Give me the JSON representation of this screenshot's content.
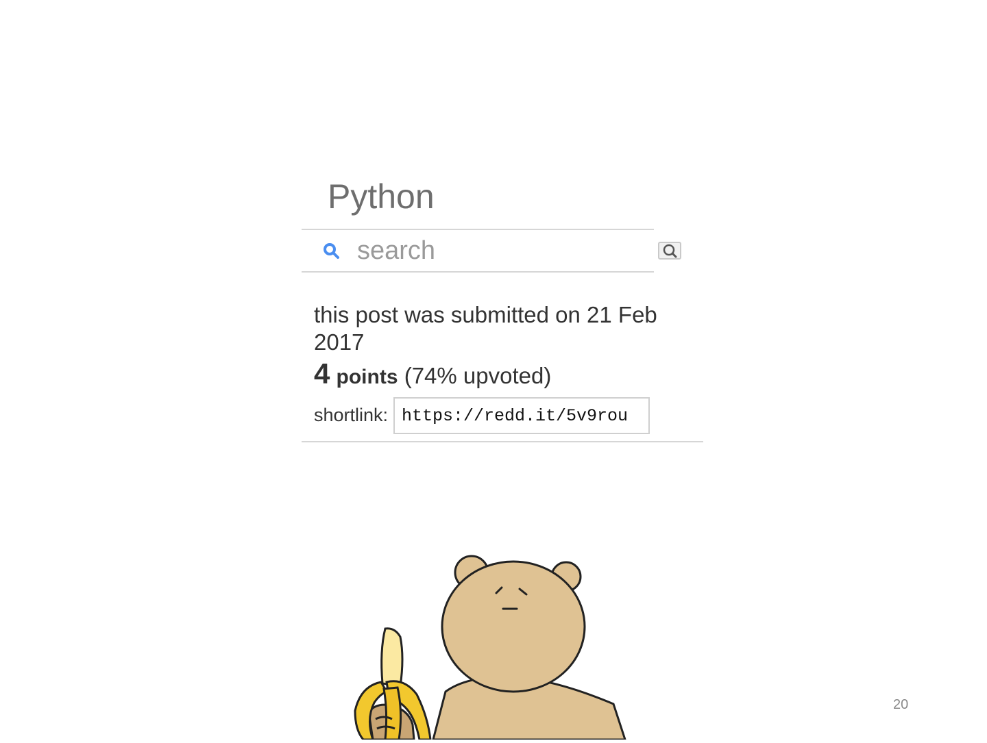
{
  "header": {
    "title": "Python"
  },
  "search": {
    "placeholder": "search",
    "value": ""
  },
  "post": {
    "submitted_text": "this post was submitted on 21 Feb 2017",
    "points_number": "4",
    "points_label": "points",
    "upvoted_text": "(74% upvoted)",
    "shortlink_label": "shortlink:",
    "shortlink_value": "https://redd.it/5v9rou"
  },
  "slide": {
    "page_number": "20"
  },
  "colors": {
    "search_icon": "#4a8ef0",
    "bear_fill": "#dfc293",
    "banana_fill": "#f2c82e",
    "banana_flesh": "#fbe9a2"
  }
}
